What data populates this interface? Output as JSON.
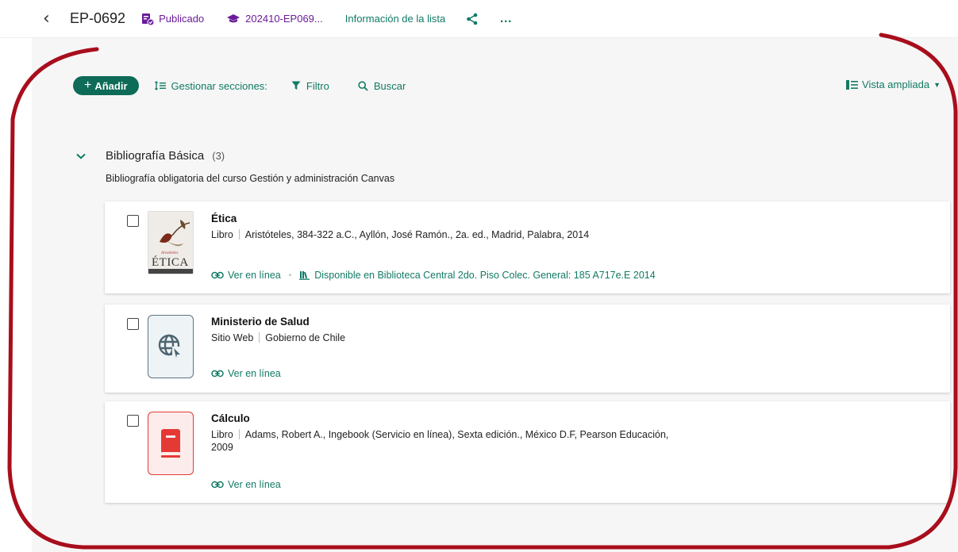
{
  "header": {
    "list_code": "EP-0692",
    "status": "Publicado",
    "course": "202410-EP069...",
    "info_link": "Información de la lista"
  },
  "toolbar": {
    "add_label": "Añadir",
    "manage_sections": "Gestionar secciones:",
    "filter": "Filtro",
    "search": "Buscar",
    "view": "Vista ampliada"
  },
  "section": {
    "title": "Bibliografía Básica",
    "count": "(3)",
    "description": "Bibliografía obligatoria del curso Gestión y administración Canvas"
  },
  "items": [
    {
      "title": "Ética",
      "type": "Libro",
      "details": "Aristóteles, 384-322 a.C., Ayllón, José Ramón., 2a. ed., Madrid, Palabra, 2014",
      "link_online": "Ver en línea",
      "availability": "Disponible en Biblioteca Central 2do. Piso Colec. General: 185 A717e.E 2014",
      "cover_text": "ÉTICA",
      "cover_small_text": "Aristóteles"
    },
    {
      "title": "Ministerio de Salud",
      "type": "Sitio Web",
      "details": "Gobierno de Chile",
      "link_online": "Ver en línea"
    },
    {
      "title": "Cálculo",
      "type": "Libro",
      "details": "Adams, Robert A., Ingebook (Servicio en línea), Sexta edición., México D.F, Pearson Educación, 2009",
      "link_online": "Ver en línea"
    }
  ],
  "colors": {
    "accent": "#117a65",
    "primary_button": "#0e6b57",
    "status_purple": "#6a1b9a",
    "annotation_red": "#a80e1c",
    "book_icon_red": "#e53935"
  }
}
